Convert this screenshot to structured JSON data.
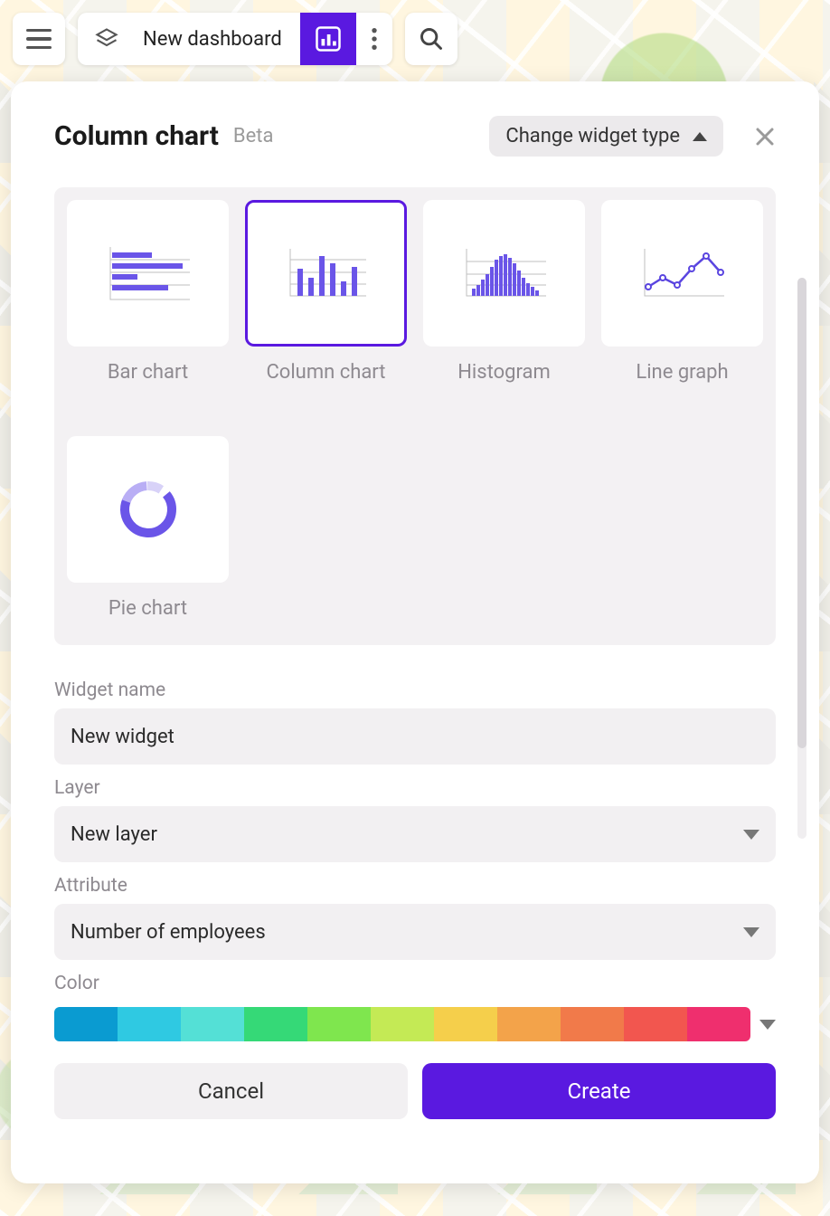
{
  "toolbar": {
    "dashboard_title": "New dashboard"
  },
  "modal": {
    "title": "Column chart",
    "beta_tag": "Beta",
    "change_type_label": "Change widget type"
  },
  "widget_types": [
    {
      "label": "Bar chart"
    },
    {
      "label": "Column chart"
    },
    {
      "label": "Histogram"
    },
    {
      "label": "Line graph"
    },
    {
      "label": "Pie chart"
    }
  ],
  "selected_type_index": 1,
  "form": {
    "widget_name_label": "Widget name",
    "widget_name_value": "New widget",
    "layer_label": "Layer",
    "layer_value": "New layer",
    "attribute_label": "Attribute",
    "attribute_value": "Number of employees",
    "color_label": "Color"
  },
  "color_palette": [
    "#0a9bd1",
    "#2fc9e2",
    "#54e0d6",
    "#35d977",
    "#7fe64e",
    "#c4ea55",
    "#f5cf4b",
    "#f3a34a",
    "#f17a4a",
    "#f2564f",
    "#ef2f6e"
  ],
  "buttons": {
    "cancel": "Cancel",
    "create": "Create"
  }
}
